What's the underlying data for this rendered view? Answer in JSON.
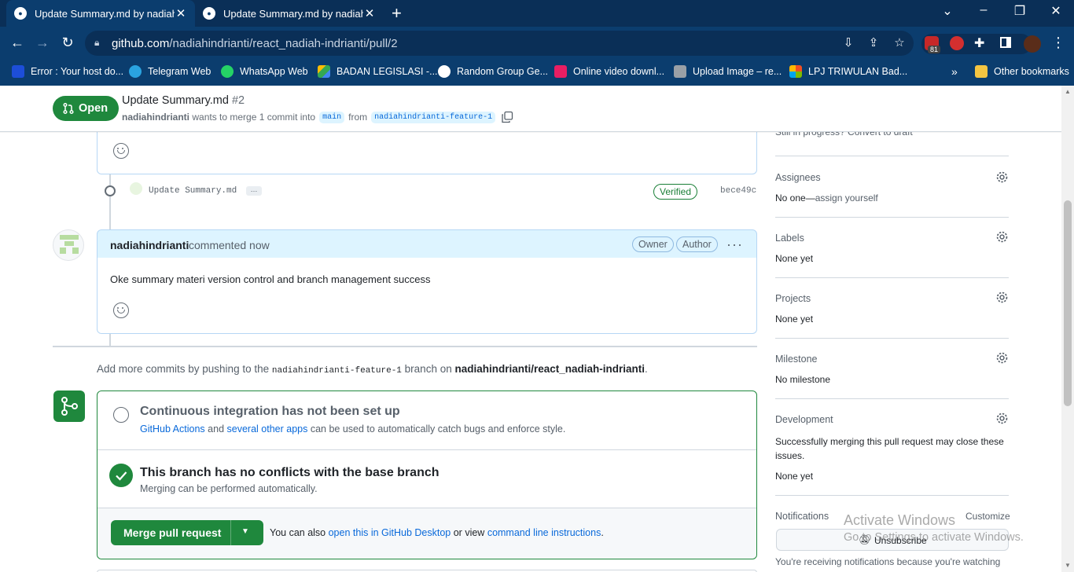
{
  "browser": {
    "tabs": [
      {
        "title": "Update Summary.md by nadiahin",
        "active": true
      },
      {
        "title": "Update Summary.md by nadiahin",
        "active": false
      }
    ],
    "url_host": "github.com",
    "url_path": "/nadiahindrianti/react_nadiah-indrianti/pull/2",
    "extension_badge": "81",
    "bookmarks": [
      {
        "label": "Error : Your host do...",
        "icon": "vmw-icon",
        "color": "#1d4ed8"
      },
      {
        "label": "Telegram Web",
        "icon": "telegram-icon",
        "color": "#2aa3e0"
      },
      {
        "label": "WhatsApp Web",
        "icon": "whatsapp-icon",
        "color": "#25d366"
      },
      {
        "label": "BADAN LEGISLASI -...",
        "icon": "drive-icon",
        "color": "#fbbc04"
      },
      {
        "label": "Random Group Ge...",
        "icon": "random-group-icon",
        "color": "#ffffff"
      },
      {
        "label": "Online video downl...",
        "icon": "video-download-icon",
        "color": "#e91e63"
      },
      {
        "label": "Upload Image – re...",
        "icon": "upload-image-icon",
        "color": "#9aa0a6"
      },
      {
        "label": "LPJ TRIWULAN Bad...",
        "icon": "microsoft-icon",
        "color": "#f25022"
      }
    ],
    "bookmarks_more": "»",
    "other_bookmarks": "Other bookmarks"
  },
  "pr": {
    "state": "Open",
    "title": "Update Summary.md",
    "number": "#2",
    "author": "nadiahindrianti",
    "merge_text": "wants to merge 1 commit into",
    "base_branch": "main",
    "from_text": "from",
    "head_branch": "nadiahindrianti-feature-1"
  },
  "timeline": {
    "commit_message": "Update Summary.md",
    "commit_more": "…",
    "verified": "Verified",
    "sha": "bece49c",
    "comment_author": "nadiahindrianti",
    "comment_time": "commented now",
    "badge_owner": "Owner",
    "badge_author": "Author",
    "comment_body": "Oke summary materi version control and branch management success",
    "push_text_1": "Add more commits by pushing to the",
    "push_branch": "nadiahindrianti-feature-1",
    "push_text_2": "branch on",
    "push_repo": "nadiahindrianti/react_nadiah-indrianti",
    "push_text_3": "."
  },
  "merge": {
    "ci_title": "Continuous integration has not been set up",
    "ci_link1": "GitHub Actions",
    "ci_and": "and",
    "ci_link2": "several other apps",
    "ci_rest": "can be used to automatically catch bugs and enforce style.",
    "conflict_title": "This branch has no conflicts with the base branch",
    "conflict_sub": "Merging can be performed automatically.",
    "merge_button": "Merge pull request",
    "also_text": "You can also",
    "desktop_link": "open this in GitHub Desktop",
    "or_view": "or view",
    "cli_link": "command line instructions",
    "period": "."
  },
  "sidebar": {
    "top_partial": "Still in progress? Convert to draft",
    "assignees_label": "Assignees",
    "assignees_value": "No one—",
    "assign_yourself": "assign yourself",
    "labels_label": "Labels",
    "labels_value": "None yet",
    "projects_label": "Projects",
    "projects_value": "None yet",
    "milestone_label": "Milestone",
    "milestone_value": "No milestone",
    "development_label": "Development",
    "development_desc": "Successfully merging this pull request may close these issues.",
    "development_value": "None yet",
    "notifications_label": "Notifications",
    "customize": "Customize",
    "unsubscribe": "Unsubscribe",
    "notif_text": "You're receiving notifications because you're watching"
  },
  "watermark": {
    "line1": "Activate Windows",
    "line2": "Go to Settings to activate Windows."
  },
  "colors": {
    "open_green": "#1f883d",
    "link_blue": "#0969da",
    "chrome_blue": "#0b3d6e"
  }
}
